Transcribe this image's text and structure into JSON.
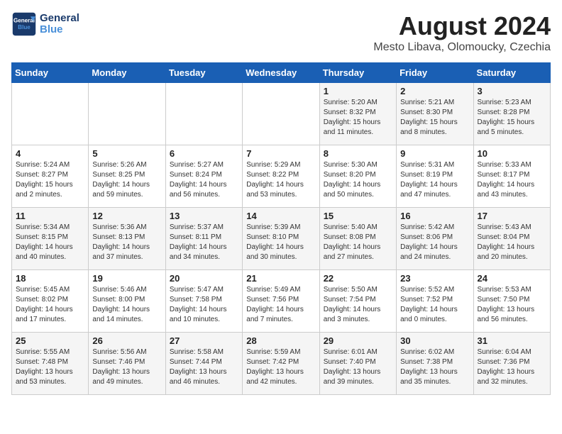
{
  "logo": {
    "line1": "General",
    "line2": "Blue"
  },
  "title": "August 2024",
  "subtitle": "Mesto Libava, Olomoucky, Czechia",
  "headers": [
    "Sunday",
    "Monday",
    "Tuesday",
    "Wednesday",
    "Thursday",
    "Friday",
    "Saturday"
  ],
  "weeks": [
    [
      {
        "day": "",
        "detail": ""
      },
      {
        "day": "",
        "detail": ""
      },
      {
        "day": "",
        "detail": ""
      },
      {
        "day": "",
        "detail": ""
      },
      {
        "day": "1",
        "detail": "Sunrise: 5:20 AM\nSunset: 8:32 PM\nDaylight: 15 hours\nand 11 minutes."
      },
      {
        "day": "2",
        "detail": "Sunrise: 5:21 AM\nSunset: 8:30 PM\nDaylight: 15 hours\nand 8 minutes."
      },
      {
        "day": "3",
        "detail": "Sunrise: 5:23 AM\nSunset: 8:28 PM\nDaylight: 15 hours\nand 5 minutes."
      }
    ],
    [
      {
        "day": "4",
        "detail": "Sunrise: 5:24 AM\nSunset: 8:27 PM\nDaylight: 15 hours\nand 2 minutes."
      },
      {
        "day": "5",
        "detail": "Sunrise: 5:26 AM\nSunset: 8:25 PM\nDaylight: 14 hours\nand 59 minutes."
      },
      {
        "day": "6",
        "detail": "Sunrise: 5:27 AM\nSunset: 8:24 PM\nDaylight: 14 hours\nand 56 minutes."
      },
      {
        "day": "7",
        "detail": "Sunrise: 5:29 AM\nSunset: 8:22 PM\nDaylight: 14 hours\nand 53 minutes."
      },
      {
        "day": "8",
        "detail": "Sunrise: 5:30 AM\nSunset: 8:20 PM\nDaylight: 14 hours\nand 50 minutes."
      },
      {
        "day": "9",
        "detail": "Sunrise: 5:31 AM\nSunset: 8:19 PM\nDaylight: 14 hours\nand 47 minutes."
      },
      {
        "day": "10",
        "detail": "Sunrise: 5:33 AM\nSunset: 8:17 PM\nDaylight: 14 hours\nand 43 minutes."
      }
    ],
    [
      {
        "day": "11",
        "detail": "Sunrise: 5:34 AM\nSunset: 8:15 PM\nDaylight: 14 hours\nand 40 minutes."
      },
      {
        "day": "12",
        "detail": "Sunrise: 5:36 AM\nSunset: 8:13 PM\nDaylight: 14 hours\nand 37 minutes."
      },
      {
        "day": "13",
        "detail": "Sunrise: 5:37 AM\nSunset: 8:11 PM\nDaylight: 14 hours\nand 34 minutes."
      },
      {
        "day": "14",
        "detail": "Sunrise: 5:39 AM\nSunset: 8:10 PM\nDaylight: 14 hours\nand 30 minutes."
      },
      {
        "day": "15",
        "detail": "Sunrise: 5:40 AM\nSunset: 8:08 PM\nDaylight: 14 hours\nand 27 minutes."
      },
      {
        "day": "16",
        "detail": "Sunrise: 5:42 AM\nSunset: 8:06 PM\nDaylight: 14 hours\nand 24 minutes."
      },
      {
        "day": "17",
        "detail": "Sunrise: 5:43 AM\nSunset: 8:04 PM\nDaylight: 14 hours\nand 20 minutes."
      }
    ],
    [
      {
        "day": "18",
        "detail": "Sunrise: 5:45 AM\nSunset: 8:02 PM\nDaylight: 14 hours\nand 17 minutes."
      },
      {
        "day": "19",
        "detail": "Sunrise: 5:46 AM\nSunset: 8:00 PM\nDaylight: 14 hours\nand 14 minutes."
      },
      {
        "day": "20",
        "detail": "Sunrise: 5:47 AM\nSunset: 7:58 PM\nDaylight: 14 hours\nand 10 minutes."
      },
      {
        "day": "21",
        "detail": "Sunrise: 5:49 AM\nSunset: 7:56 PM\nDaylight: 14 hours\nand 7 minutes."
      },
      {
        "day": "22",
        "detail": "Sunrise: 5:50 AM\nSunset: 7:54 PM\nDaylight: 14 hours\nand 3 minutes."
      },
      {
        "day": "23",
        "detail": "Sunrise: 5:52 AM\nSunset: 7:52 PM\nDaylight: 14 hours\nand 0 minutes."
      },
      {
        "day": "24",
        "detail": "Sunrise: 5:53 AM\nSunset: 7:50 PM\nDaylight: 13 hours\nand 56 minutes."
      }
    ],
    [
      {
        "day": "25",
        "detail": "Sunrise: 5:55 AM\nSunset: 7:48 PM\nDaylight: 13 hours\nand 53 minutes."
      },
      {
        "day": "26",
        "detail": "Sunrise: 5:56 AM\nSunset: 7:46 PM\nDaylight: 13 hours\nand 49 minutes."
      },
      {
        "day": "27",
        "detail": "Sunrise: 5:58 AM\nSunset: 7:44 PM\nDaylight: 13 hours\nand 46 minutes."
      },
      {
        "day": "28",
        "detail": "Sunrise: 5:59 AM\nSunset: 7:42 PM\nDaylight: 13 hours\nand 42 minutes."
      },
      {
        "day": "29",
        "detail": "Sunrise: 6:01 AM\nSunset: 7:40 PM\nDaylight: 13 hours\nand 39 minutes."
      },
      {
        "day": "30",
        "detail": "Sunrise: 6:02 AM\nSunset: 7:38 PM\nDaylight: 13 hours\nand 35 minutes."
      },
      {
        "day": "31",
        "detail": "Sunrise: 6:04 AM\nSunset: 7:36 PM\nDaylight: 13 hours\nand 32 minutes."
      }
    ]
  ]
}
